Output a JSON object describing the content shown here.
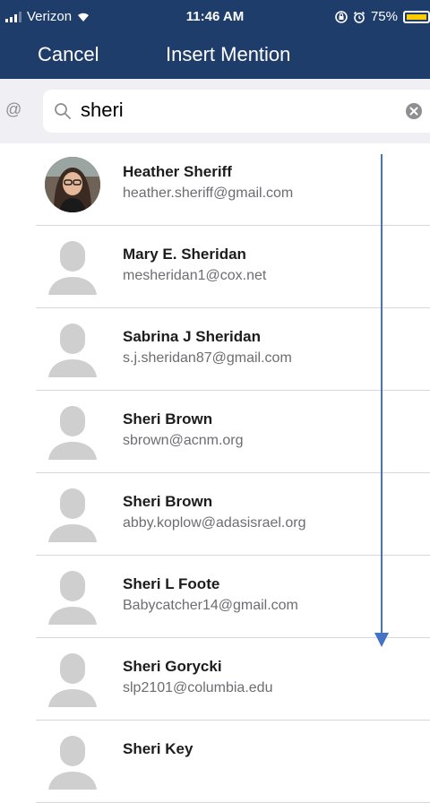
{
  "status_bar": {
    "carrier": "Verizon",
    "time": "11:46 AM",
    "battery": "75%",
    "battery_level": 0.75,
    "icons": [
      "signal-icon",
      "wifi-icon",
      "lock-rotation-icon",
      "alarm-icon",
      "battery-icon"
    ]
  },
  "nav": {
    "cancel_label": "Cancel",
    "title": "Insert Mention"
  },
  "search": {
    "prefix": "@",
    "value": "sheri"
  },
  "contacts": [
    {
      "name": "Heather Sheriff",
      "email": "heather.sheriff@gmail.com",
      "avatar": "photo"
    },
    {
      "name": "Mary E. Sheridan",
      "email": "mesheridan1@cox.net",
      "avatar": "placeholder"
    },
    {
      "name": "Sabrina J Sheridan",
      "email": "s.j.sheridan87@gmail.com",
      "avatar": "placeholder"
    },
    {
      "name": "Sheri Brown",
      "email": "sbrown@acnm.org",
      "avatar": "placeholder"
    },
    {
      "name": "Sheri Brown",
      "email": "abby.koplow@adasisrael.org",
      "avatar": "placeholder"
    },
    {
      "name": "Sheri L Foote",
      "email": "Babycatcher14@gmail.com",
      "avatar": "placeholder"
    },
    {
      "name": "Sheri Gorycki",
      "email": "slp2101@columbia.edu",
      "avatar": "placeholder"
    },
    {
      "name": "Sheri Key",
      "email": "",
      "avatar": "placeholder"
    }
  ],
  "colors": {
    "header_bg": "#1f3d6b",
    "arrow": "#4472c4",
    "battery_fill": "#ffcc00"
  }
}
